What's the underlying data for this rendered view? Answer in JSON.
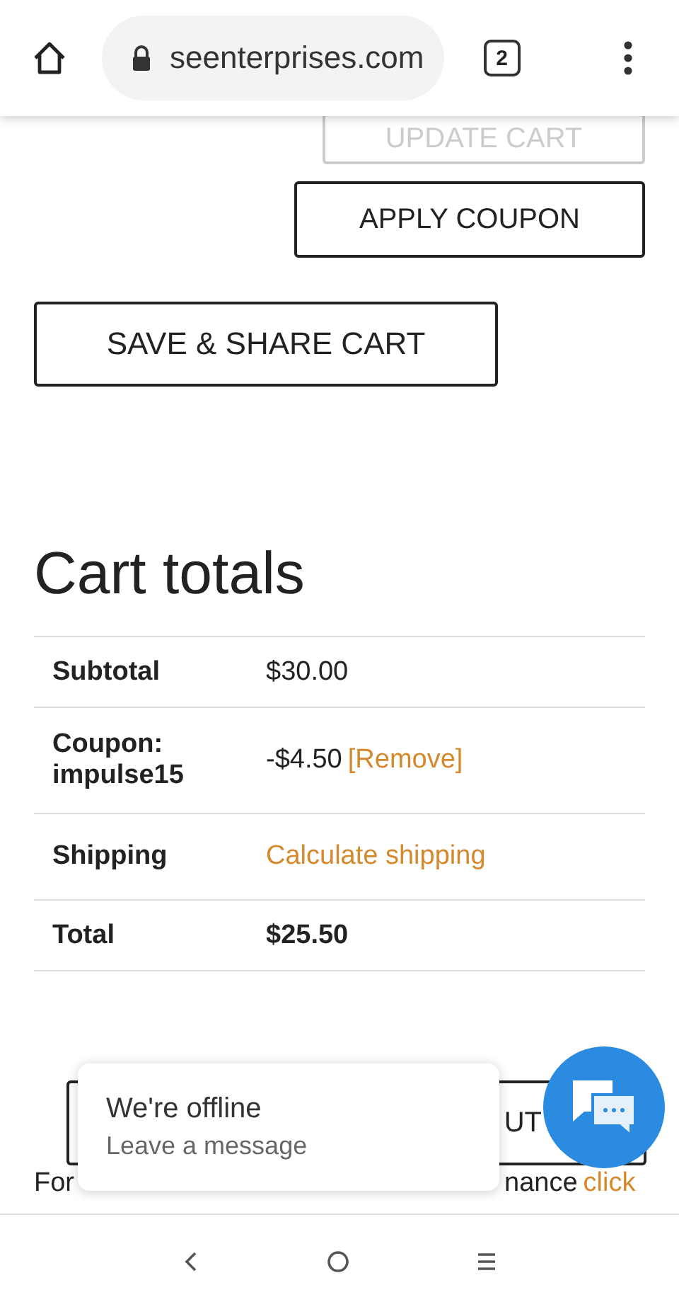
{
  "browser": {
    "url": "seenterprises.com",
    "tab_count": "2"
  },
  "cart_actions": [
    {
      "label": "UPDATE CART",
      "disabled": true
    },
    {
      "label": "APPLY COUPON",
      "disabled": false
    }
  ],
  "save_button": "SAVE & SHARE CART",
  "cart_totals": {
    "title": "Cart totals",
    "rows": [
      {
        "label": "Subtotal",
        "value": "$30.00",
        "kind": "plain"
      },
      {
        "label": "Coupon: impulse15",
        "value": "-$4.50",
        "link": "[Remove]",
        "kind": "coupon"
      },
      {
        "label": "Shipping",
        "link": "Calculate shipping",
        "kind": "link"
      },
      {
        "label": "Total",
        "value": "$25.50",
        "kind": "total"
      }
    ]
  },
  "checkout_button": {
    "label": "UT"
  },
  "care_note": {
    "before": "For",
    "after": "nance",
    "link": "click"
  },
  "chat_popup": {
    "title": "We're offline",
    "subtitle": "Leave a message"
  }
}
